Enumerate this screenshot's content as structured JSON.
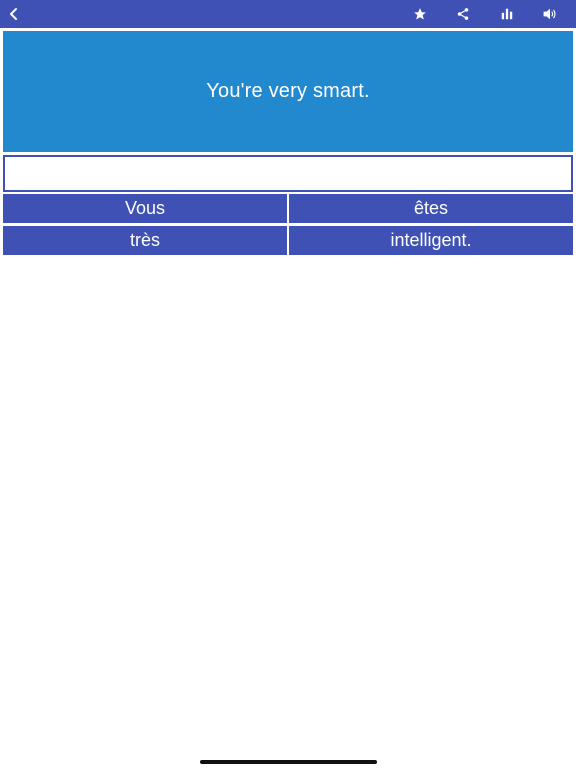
{
  "toolbar": {
    "icons": [
      "back-icon",
      "star-icon",
      "share-icon",
      "stats-icon",
      "speaker-icon"
    ],
    "accent_color": "#3f51b5"
  },
  "prompt": {
    "text": "You're very smart.",
    "background_color": "#2289ce"
  },
  "answer": {
    "value": ""
  },
  "word_choices": [
    "Vous",
    "êtes",
    "très",
    "intelligent."
  ]
}
